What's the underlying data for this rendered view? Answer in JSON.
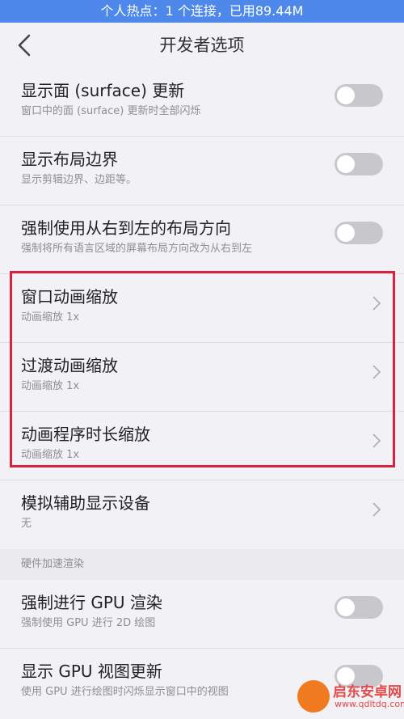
{
  "status_bar": {
    "text": "个人热点：1 个连接，已用89.44M"
  },
  "header": {
    "title": "开发者选项",
    "back_icon": "chevron-left-icon"
  },
  "items": [
    {
      "title": "显示面 (surface) 更新",
      "subtitle": "窗口中的面 (surface) 更新时全部闪烁",
      "control": "toggle",
      "on": false
    },
    {
      "title": "显示布局边界",
      "subtitle": "显示剪辑边界、边距等。",
      "control": "toggle",
      "on": false
    },
    {
      "title": "强制使用从右到左的布局方向",
      "subtitle": "强制将所有语言区域的屏幕布局方向改为从右到左",
      "control": "toggle",
      "on": false
    },
    {
      "title": "窗口动画缩放",
      "subtitle": "动画缩放 1x",
      "control": "chevron"
    },
    {
      "title": "过渡动画缩放",
      "subtitle": "动画缩放 1x",
      "control": "chevron"
    },
    {
      "title": "动画程序时长缩放",
      "subtitle": "动画缩放 1x",
      "control": "chevron"
    },
    {
      "title": "模拟辅助显示设备",
      "subtitle": "无",
      "control": "chevron"
    }
  ],
  "section_hw": {
    "label": "硬件加速渲染"
  },
  "hw_items": [
    {
      "title": "强制进行 GPU 渲染",
      "subtitle": "强制使用 GPU 进行 2D 绘图",
      "control": "toggle",
      "on": false
    },
    {
      "title": "显示 GPU 视图更新",
      "subtitle": "使用 GPU 进行绘图时闪烁显示窗口中的视图",
      "control": "toggle",
      "on": false
    }
  ],
  "watermark": {
    "name": "启东安卓网",
    "url": "www.qdltdq.com"
  },
  "colors": {
    "status_bar": "#4d88ea",
    "highlight": "#d9223c",
    "background": "#f2f1f5"
  }
}
